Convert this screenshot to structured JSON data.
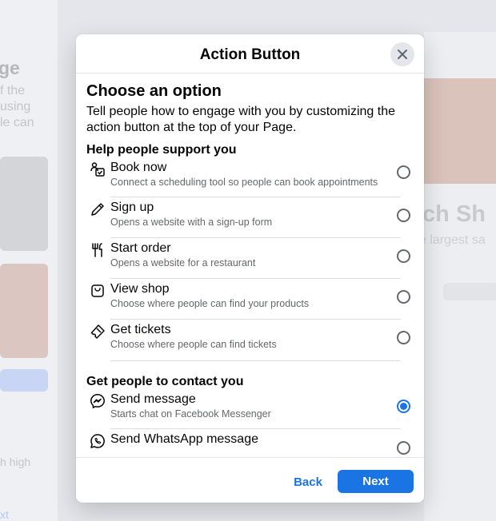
{
  "background": {
    "left_title": "ge",
    "left_text_lines": [
      "f the",
      "using",
      "le can"
    ],
    "left_text_bottom": "h high",
    "left_link": "xt",
    "right_title": "ich Sh",
    "right_subtitle": "e largest sa"
  },
  "modal": {
    "title": "Action Button",
    "heading": "Choose an option",
    "description": "Tell people how to engage with you by customizing the action button at the top of your Page.",
    "sections": [
      {
        "title": "Help people support you",
        "options": [
          {
            "label": "Book now",
            "sub": "Connect a scheduling tool so people can book appointments",
            "icon": "calendar-check-icon",
            "selected": false
          },
          {
            "label": "Sign up",
            "sub": "Opens a website with a sign-up form",
            "icon": "pencil-icon",
            "selected": false
          },
          {
            "label": "Start order",
            "sub": "Opens a website for a restaurant",
            "icon": "fork-knife-icon",
            "selected": false
          },
          {
            "label": "View shop",
            "sub": "Choose where people can find your products",
            "icon": "shopping-bag-icon",
            "selected": false
          },
          {
            "label": "Get tickets",
            "sub": "Choose where people can find tickets",
            "icon": "ticket-icon",
            "selected": false
          }
        ]
      },
      {
        "title": "Get people to contact you",
        "options": [
          {
            "label": "Send message",
            "sub": "Starts chat on Facebook Messenger",
            "icon": "messenger-icon",
            "selected": true
          },
          {
            "label": "Send WhatsApp message",
            "sub": "",
            "icon": "whatsapp-icon",
            "selected": false
          }
        ]
      }
    ],
    "back_label": "Back",
    "next_label": "Next"
  },
  "colors": {
    "accent": "#1b74e4",
    "secondary_text": "#65676b",
    "divider": "#dadde1"
  }
}
